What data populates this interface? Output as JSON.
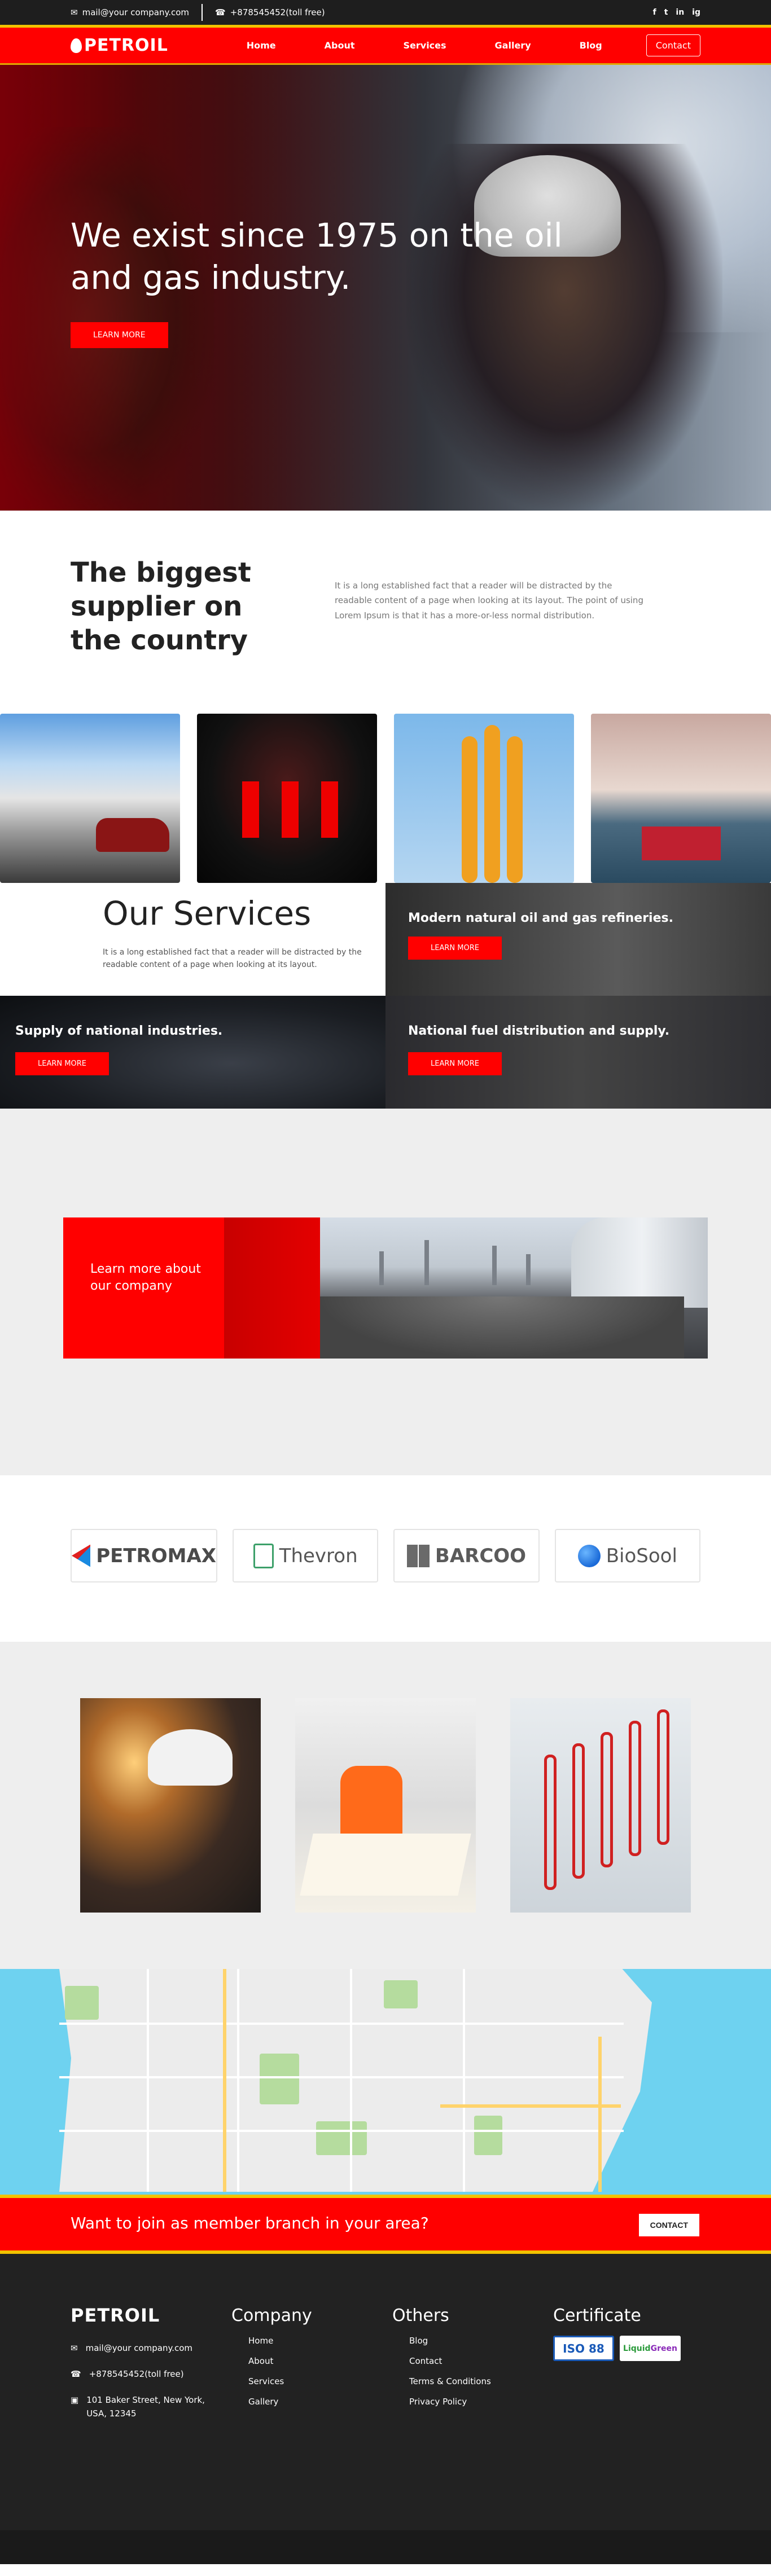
{
  "topbar": {
    "email": "mail@your company.com",
    "phone": "+878545452(toll free)",
    "social": [
      "f",
      "t",
      "in",
      "ig"
    ]
  },
  "navbar": {
    "logo": "PETROIL",
    "links": [
      "Home",
      "About",
      "Services",
      "Gallery",
      "Blog"
    ],
    "contact": "Contact"
  },
  "hero": {
    "title": "We exist since 1975 on the oil and gas industry.",
    "button": "LEARN MORE"
  },
  "supplier": {
    "title": "The biggest supplier on the country",
    "text": "It is a long established fact that a reader will be distracted by the readable content of a page when looking at its layout. The point of using Lorem Ipsum is that it has a more-or-less normal distribution."
  },
  "services": {
    "title": "Our Services",
    "description": "It is a long established fact that a reader will be distracted by the readable content of a page when looking at its layout.",
    "cards": [
      {
        "title": "Modern natural oil and gas refineries.",
        "button": "LEARN MORE"
      },
      {
        "title": "Supply of national industries.",
        "button": "LEARN MORE"
      },
      {
        "title": "National fuel distribution and supply.",
        "button": "LEARN MORE"
      }
    ]
  },
  "learn": {
    "text": "Learn more about our company"
  },
  "partners": [
    "PETROMAX",
    "Thevron",
    "BARCOO",
    "BioSool"
  ],
  "join": {
    "text": "Want to join as member branch in your area?",
    "button": "CONTACT"
  },
  "footer": {
    "logo": "PETROIL",
    "email": "mail@your company.com",
    "phone": "+878545452(toll free)",
    "address": "101 Baker Street, New York, USA, 12345",
    "company_title": "Company",
    "company_links": [
      "Home",
      "About",
      "Services",
      "Gallery"
    ],
    "others_title": "Others",
    "others_links": [
      "Blog",
      "Contact",
      "Terms & Conditions",
      "Privacy Policy"
    ],
    "certificate_title": "Certificate",
    "cert_iso": "ISO 88",
    "cert_green_a": "Liquid",
    "cert_green_b": "Green"
  },
  "colors": {
    "brand_red": "#ff0000",
    "accent_yellow": "#f2c200",
    "dark": "#222222"
  },
  "icons": [
    "mail-icon",
    "phone-icon",
    "facebook-icon",
    "twitter-icon",
    "linkedin-icon",
    "instagram-icon",
    "address-icon"
  ]
}
